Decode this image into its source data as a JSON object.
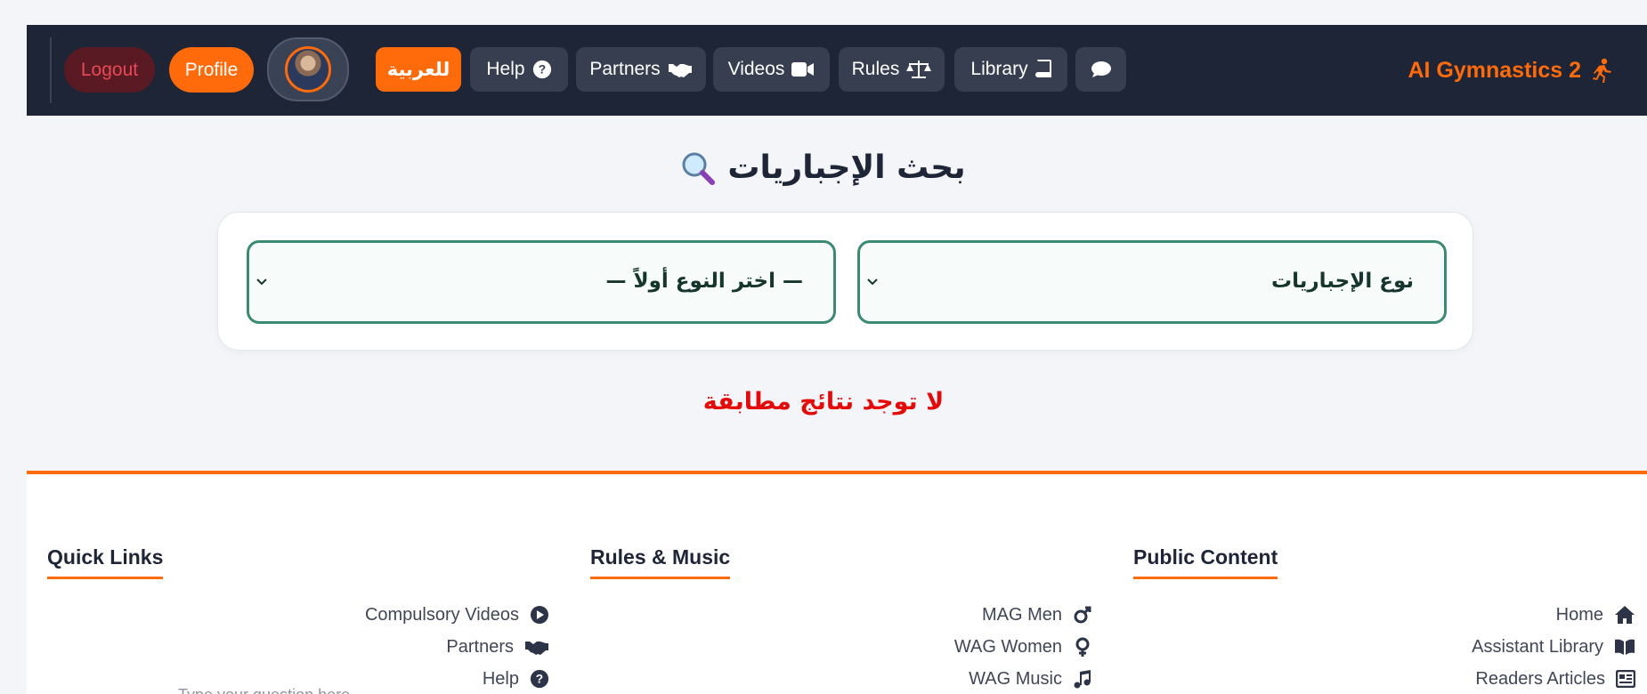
{
  "navbar": {
    "logout_label": "Logout",
    "profile_label": "Profile",
    "arabic_label": "للعربية",
    "items": [
      {
        "label": "Help",
        "icon": "question-circle-icon"
      },
      {
        "label": "Partners",
        "icon": "handshake-icon"
      },
      {
        "label": "Videos",
        "icon": "video-camera-icon"
      },
      {
        "label": "Rules",
        "icon": "scale-balance-icon"
      },
      {
        "label": "Library",
        "icon": "book-icon"
      }
    ],
    "chat_icon": "chat-bubble-icon",
    "brand": "AI Gymnastics 2",
    "brand_icon": "running-person-icon",
    "accent_color": "#ff6b0a",
    "bg_color": "#1e2536"
  },
  "main": {
    "title": "بحث الإجباريات",
    "title_icon": "magnifier-icon",
    "selects": {
      "type_selected": "نوع الإجباريات",
      "subtype_selected": "— اختر النوع أولاً —"
    },
    "no_results": "لا توجد نتائج مطابقة"
  },
  "footer": {
    "columns": [
      {
        "heading": "Quick Links",
        "links": [
          {
            "label": "Compulsory Videos",
            "icon": "play-circle-icon"
          },
          {
            "label": "Partners",
            "icon": "handshake-icon"
          },
          {
            "label": "Help",
            "icon": "question-circle-icon"
          }
        ]
      },
      {
        "heading": "Rules & Music",
        "links": [
          {
            "label": "MAG Men",
            "icon": "male-symbol-icon"
          },
          {
            "label": "WAG Women",
            "icon": "female-symbol-icon"
          },
          {
            "label": "WAG Music",
            "icon": "music-note-icon"
          }
        ]
      },
      {
        "heading": "Public Content",
        "links": [
          {
            "label": "Home",
            "icon": "home-icon"
          },
          {
            "label": "Assistant Library",
            "icon": "open-book-icon"
          },
          {
            "label": "Readers Articles",
            "icon": "newspaper-icon"
          }
        ]
      }
    ],
    "partial_input_hint": "Type your question here..."
  }
}
